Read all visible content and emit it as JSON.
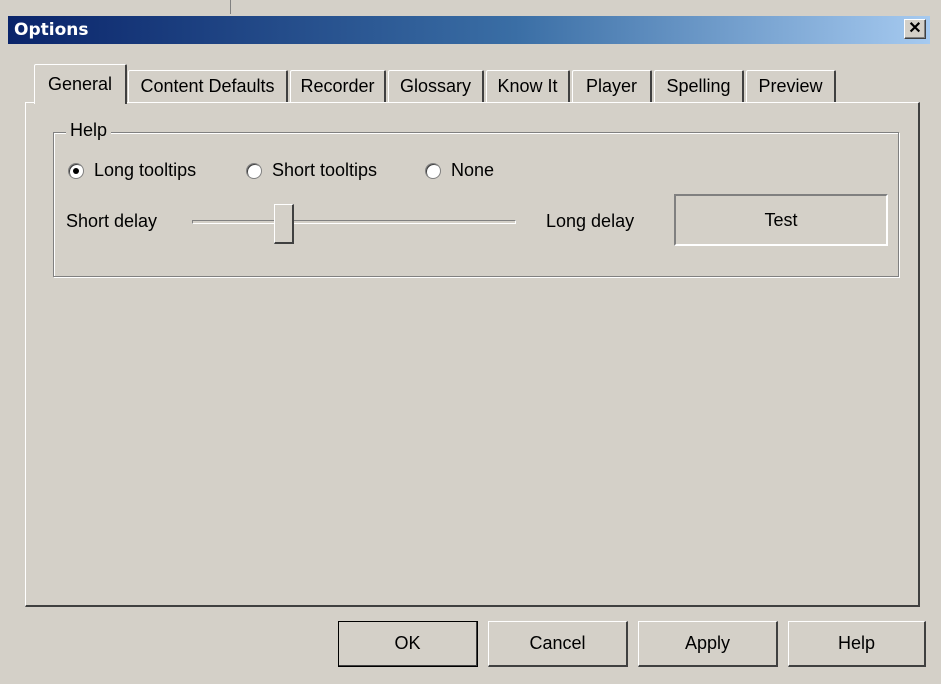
{
  "window": {
    "title": "Options",
    "close_symbol": "✕"
  },
  "tabs": [
    {
      "label": "General",
      "active": true
    },
    {
      "label": "Content Defaults",
      "active": false
    },
    {
      "label": "Recorder",
      "active": false
    },
    {
      "label": "Glossary",
      "active": false
    },
    {
      "label": "Know It",
      "active": false
    },
    {
      "label": "Player",
      "active": false
    },
    {
      "label": "Spelling",
      "active": false
    },
    {
      "label": "Preview",
      "active": false
    }
  ],
  "help_group": {
    "label": "Help",
    "radios": [
      {
        "label": "Long tooltips",
        "checked": true
      },
      {
        "label": "Short tooltips",
        "checked": false
      },
      {
        "label": "None",
        "checked": false
      }
    ],
    "slider": {
      "min_label": "Short delay",
      "max_label": "Long delay",
      "value_fraction": 0.27
    },
    "test_button": "Test"
  },
  "buttons": {
    "ok": "OK",
    "cancel": "Cancel",
    "apply": "Apply",
    "help": "Help"
  },
  "colors": {
    "face": "#d4d0c8",
    "title_start": "#0a246a",
    "title_end": "#a6caf0"
  }
}
